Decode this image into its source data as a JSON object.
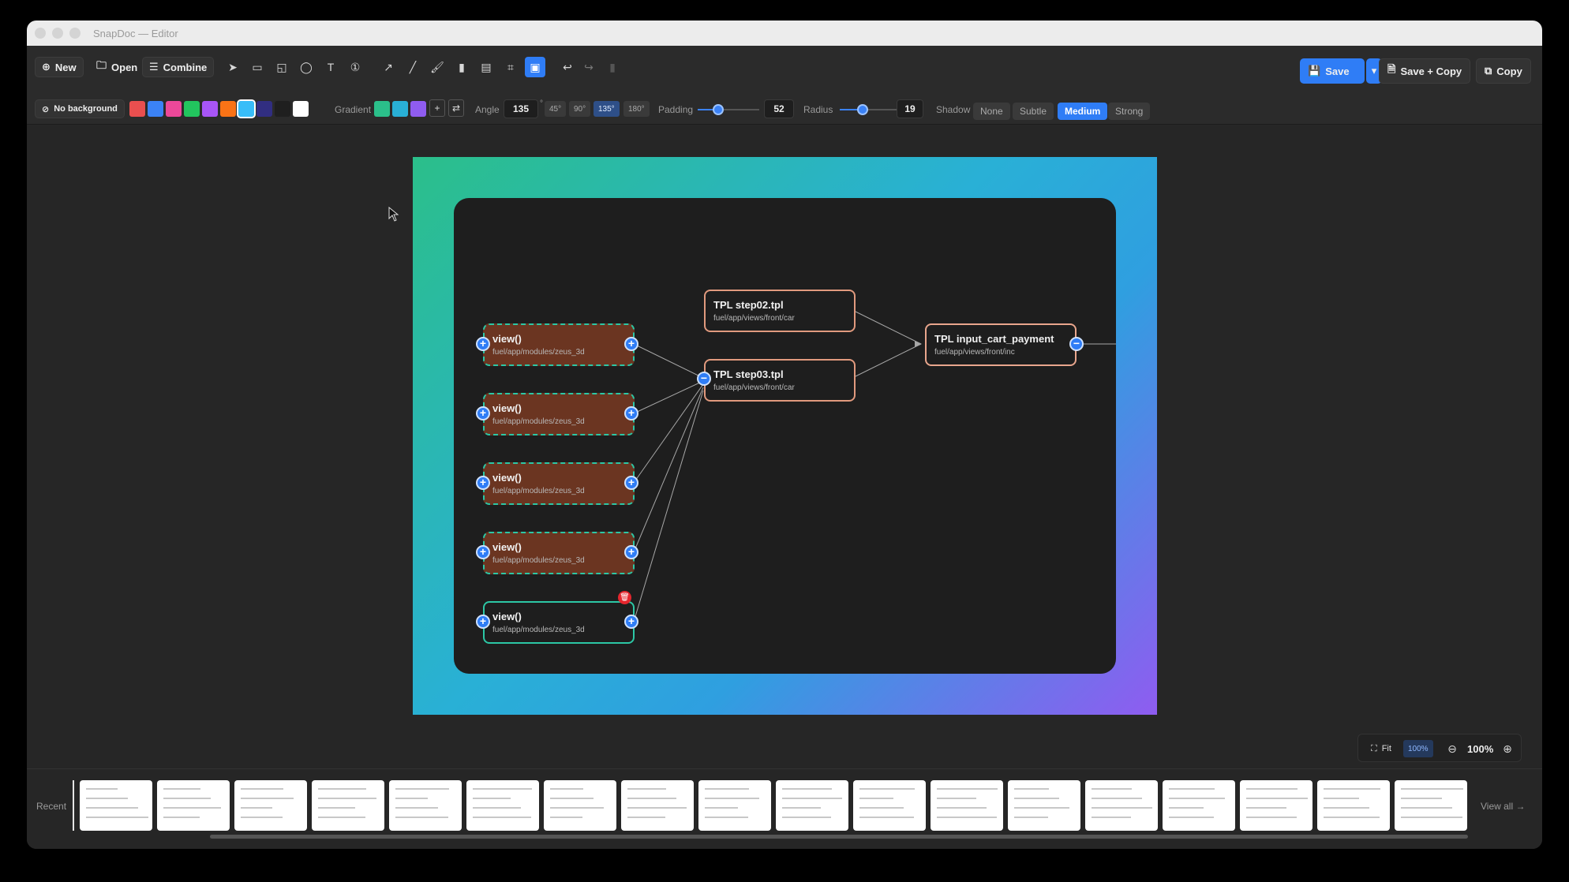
{
  "window": {
    "title": "SnapDoc — Editor"
  },
  "toolbar": {
    "new_label": "New",
    "open_label": "Open",
    "combine_label": "Combine",
    "save_label": "Save",
    "save_copy_label": "Save + Copy",
    "copy_label": "Copy"
  },
  "background": {
    "no_bg_label": "No background",
    "gradient_label": "Gradient",
    "swatches": [
      "#e94f4f",
      "#3b82f6",
      "#ec4899",
      "#22c55e",
      "#a855f7",
      "#f97316",
      "#38bdf8",
      "#312e81",
      "#1f1f1f",
      "#ffffff"
    ],
    "gradient_swatches": [
      "#2bbf8a",
      "#29b0d6",
      "#8f5cf0"
    ],
    "angle_label": "Angle",
    "angle_value": "135",
    "angle_presets": [
      "45°",
      "90°",
      "135°",
      "180°"
    ],
    "padding_label": "Padding",
    "padding_value": "52",
    "radius_label": "Radius",
    "radius_value": "19",
    "shadow_label": "Shadow",
    "shadow_options": [
      "None",
      "Subtle",
      "Medium",
      "Strong"
    ],
    "shadow_selected": "Medium"
  },
  "diagram": {
    "view_nodes": [
      {
        "title": "view()",
        "path": "fuel/app/modules/zeus_3d"
      },
      {
        "title": "view()",
        "path": "fuel/app/modules/zeus_3d"
      },
      {
        "title": "view()",
        "path": "fuel/app/modules/zeus_3d"
      },
      {
        "title": "view()",
        "path": "fuel/app/modules/zeus_3d"
      },
      {
        "title": "view()",
        "path": "fuel/app/modules/zeus_3d"
      }
    ],
    "tpl_step02": {
      "title": "TPL step02.tpl",
      "path": "fuel/app/views/front/car"
    },
    "tpl_step03": {
      "title": "TPL step03.tpl",
      "path": "fuel/app/views/front/car"
    },
    "tpl_payment": {
      "title": "TPL input_cart_payment",
      "path": "fuel/app/views/front/inc"
    }
  },
  "zoom": {
    "fit_label": "Fit",
    "preset": "100%",
    "value": "100%"
  },
  "bottom": {
    "recent_label": "Recent",
    "view_all_label": "View all →"
  }
}
